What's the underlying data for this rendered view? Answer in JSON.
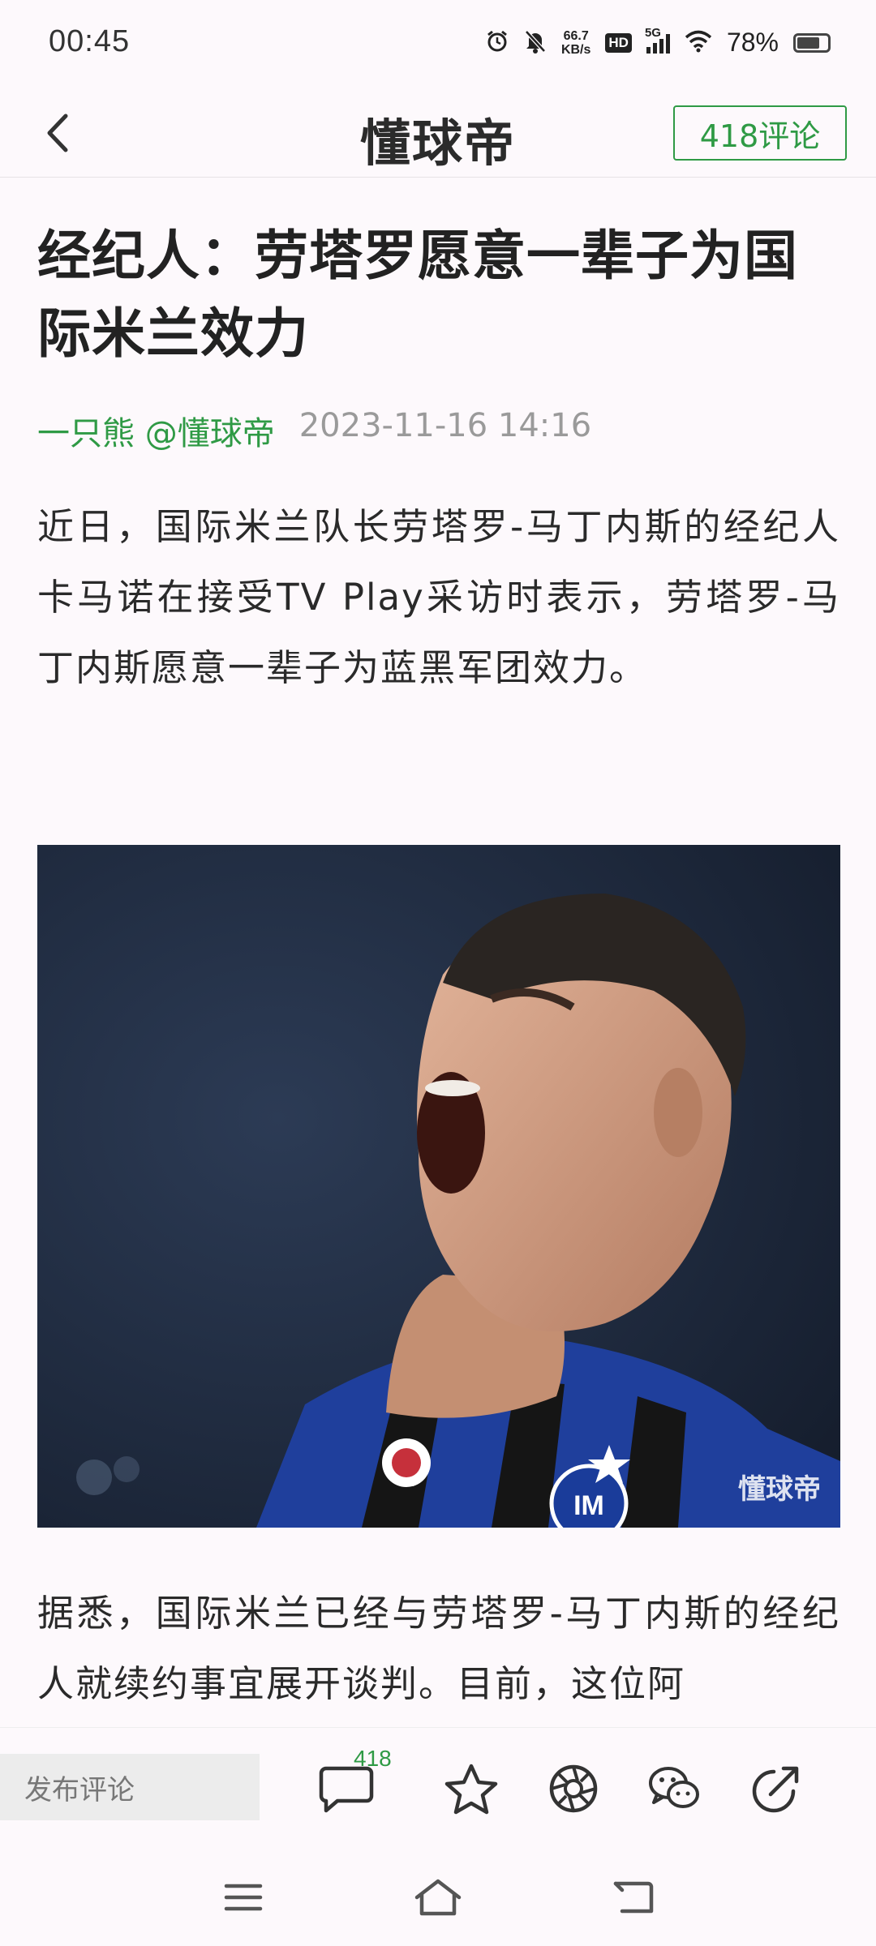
{
  "status_bar": {
    "time": "00:45",
    "net_speed_value": "66.7",
    "net_speed_unit": "KB/s",
    "hd": "HD",
    "network": "5G",
    "battery": "78%",
    "battery_level": 0.78
  },
  "header": {
    "brand": "懂球帝",
    "comment_button": "418评论"
  },
  "article": {
    "title": "经纪人：劳塔罗愿意一辈子为国际米兰效力",
    "author": "一只熊 @懂球帝",
    "date": "2023-11-16 14:16",
    "paragraph1": "近日，国际米兰队长劳塔罗-马丁内斯的经纪人卡马诺在接受TV Play采访时表示，劳塔罗-马丁内斯愿意一辈子为蓝黑军团效力。",
    "photo_watermark": "懂球帝",
    "paragraph2": "据悉，国际米兰已经与劳塔罗-马丁内斯的经纪人就续约事宜展开谈判。目前，这位阿"
  },
  "action_bar": {
    "comment_placeholder": "发布评论",
    "comment_count": "418"
  },
  "icons": [
    "back-icon",
    "alarm-icon",
    "mute-icon",
    "signal-icon",
    "wifi-icon",
    "battery-icon",
    "comment-icon",
    "star-icon",
    "moments-icon",
    "wechat-icon",
    "share-icon",
    "menu-icon",
    "home-icon",
    "back-nav-icon"
  ],
  "colors": {
    "accent": "#2f9a45",
    "background": "#fdf9fc"
  }
}
